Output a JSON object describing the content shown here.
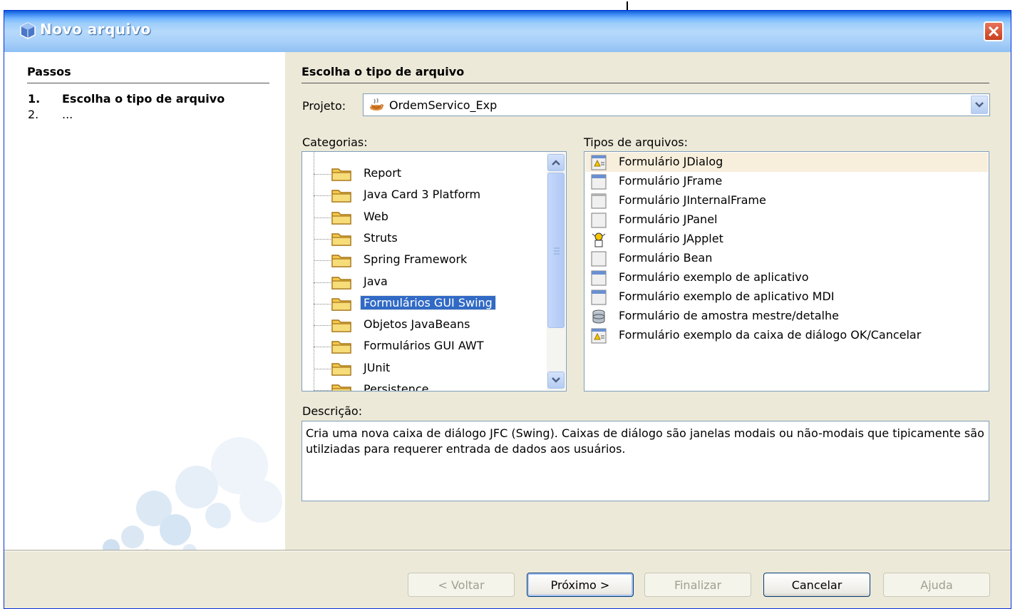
{
  "window": {
    "title": "Novo arquivo"
  },
  "steps": {
    "header": "Passos",
    "items": [
      {
        "number": "1.",
        "label": "Escolha o tipo de arquivo"
      },
      {
        "number": "2.",
        "label": "..."
      }
    ]
  },
  "main": {
    "header": "Escolha o tipo de arquivo",
    "project": {
      "label": "Projeto:",
      "value": "OrdemServico_Exp"
    },
    "categories": {
      "label": "Categorias:",
      "items": [
        "Report",
        "Java Card 3 Platform",
        "Web",
        "Struts",
        "Spring Framework",
        "Java",
        "Formulários GUI Swing",
        "Objetos JavaBeans",
        "Formulários GUI AWT",
        "JUnit",
        "Persistence"
      ],
      "selected_index": 6
    },
    "file_types": {
      "label": "Tipos de arquivos:",
      "items": [
        {
          "label": "Formulário JDialog",
          "icon": "dialog-form-icon"
        },
        {
          "label": "Formulário JFrame",
          "icon": "frame-form-icon"
        },
        {
          "label": "Formulário JInternalFrame",
          "icon": "internal-frame-form-icon"
        },
        {
          "label": "Formulário JPanel",
          "icon": "panel-form-icon"
        },
        {
          "label": "Formulário JApplet",
          "icon": "applet-form-icon"
        },
        {
          "label": "Formulário Bean",
          "icon": "bean-form-icon"
        },
        {
          "label": "Formulário exemplo de aplicativo",
          "icon": "frame-form-icon"
        },
        {
          "label": "Formulário exemplo de aplicativo MDI",
          "icon": "frame-form-icon"
        },
        {
          "label": "Formulário de amostra mestre/detalhe",
          "icon": "database-form-icon"
        },
        {
          "label": "Formulário exemplo da caixa de diálogo OK/Cancelar",
          "icon": "dialog-form-icon"
        }
      ],
      "selected_index": 0
    },
    "description": {
      "label": "Descrição:",
      "text": "Cria uma nova caixa de diálogo JFC (Swing). Caixas de diálogo são janelas modais ou não-modais que tipicamente são utilziadas para requerer entrada de dados aos usuários."
    }
  },
  "buttons": {
    "back": "< Voltar",
    "next": "Próximo >",
    "finish": "Finalizar",
    "cancel": "Cancelar",
    "help": "Ajuda"
  },
  "colors": {
    "selection": "#316ac5",
    "dialog_bg": "#ece9d8",
    "close_button": "#c7401e"
  }
}
